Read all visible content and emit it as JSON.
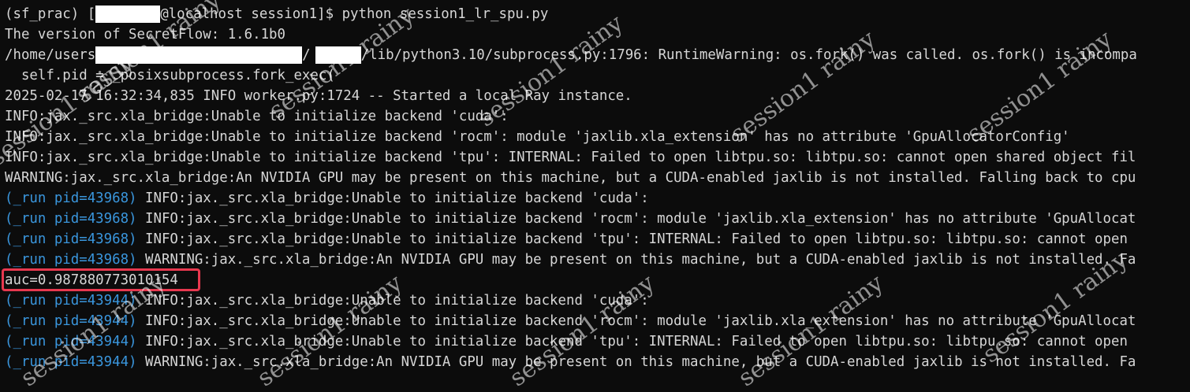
{
  "terminal": {
    "prompt_line": {
      "env": "(sf_prac)",
      "bracket_open": "[",
      "host": "@localhost session1]$",
      "command": "python session1_lr_spu.py"
    },
    "version_line": "The version of SecretFlow: 1.6.1b0",
    "path_line": {
      "start": "/home/users",
      "slash": "/",
      "tail": "/lib/python3.10/subprocess.py:1796: RuntimeWarning: os.fork() was called. os.fork() is incompa"
    },
    "plain_lines": [
      "  self.pid = _posixsubprocess.fork_exec(",
      "2025-02-17 16:32:34,835 INFO worker.py:1724 -- Started a local Ray instance.",
      "INFO:jax._src.xla_bridge:Unable to initialize backend 'cuda':",
      "INFO:jax._src.xla_bridge:Unable to initialize backend 'rocm': module 'jaxlib.xla_extension' has no attribute 'GpuAllocatorConfig'",
      "INFO:jax._src.xla_bridge:Unable to initialize backend 'tpu': INTERNAL: Failed to open libtpu.so: libtpu.so: cannot open shared object fil",
      "WARNING:jax._src.xla_bridge:An NVIDIA GPU may be present on this machine, but a CUDA-enabled jaxlib is not installed. Falling back to cpu"
    ],
    "ray_block_1": [
      {
        "prefix": "(_run pid=43968)",
        "text": " INFO:jax._src.xla_bridge:Unable to initialize backend 'cuda':"
      },
      {
        "prefix": "(_run pid=43968)",
        "text": " INFO:jax._src.xla_bridge:Unable to initialize backend 'rocm': module 'jaxlib.xla_extension' has no attribute 'GpuAllocat"
      },
      {
        "prefix": "(_run pid=43968)",
        "text": " INFO:jax._src.xla_bridge:Unable to initialize backend 'tpu': INTERNAL: Failed to open libtpu.so: libtpu.so: cannot open"
      },
      {
        "prefix": "(_run pid=43968)",
        "text": " WARNING:jax._src.xla_bridge:An NVIDIA GPU may be present on this machine, but a CUDA-enabled jaxlib is not installed. Fa"
      }
    ],
    "auc_line": "auc=0.987880773010154",
    "ray_block_2": [
      {
        "prefix": "(_run pid=43944)",
        "text": " INFO:jax._src.xla_bridge:Unable to initialize backend 'cuda':"
      },
      {
        "prefix": "(_run pid=43944)",
        "text": " INFO:jax._src.xla_bridge:Unable to initialize backend 'rocm': module 'jaxlib.xla_extension' has no attribute 'GpuAllocat"
      },
      {
        "prefix": "(_run pid=43944)",
        "text": " INFO:jax._src.xla_bridge:Unable to initialize backend 'tpu': INTERNAL: Failed to open libtpu.so: libtpu.so: cannot open"
      },
      {
        "prefix": "(_run pid=43944)",
        "text": " WARNING:jax._src.xla_bridge:An NVIDIA GPU may be present on this machine, but a CUDA-enabled jaxlib is not installed. Fa"
      }
    ],
    "watermark_text": "session1 rainy"
  },
  "colors": {
    "background": "#0c0c0c",
    "text": "#d6d6d6",
    "ray_prefix": "#3a96dd",
    "highlight_box": "#e8384f",
    "redaction": "#ffffff"
  }
}
